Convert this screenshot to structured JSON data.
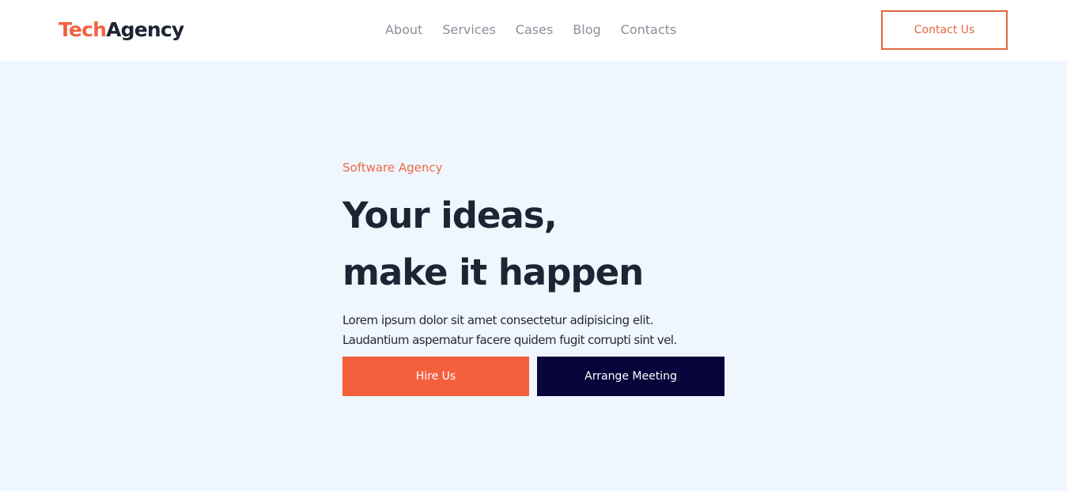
{
  "header": {
    "logo_part1": "Tech",
    "logo_part2": "Agency",
    "nav": [
      "About",
      "Services",
      "Cases",
      "Blog",
      "Contacts"
    ],
    "contact_button": "Contact Us"
  },
  "hero": {
    "eyebrow": "Software Agency",
    "headline_line1": "Your ideas,",
    "headline_line2": "make it happen",
    "lede_line1": "Lorem ipsum dolor sit amet consectetur adipisicing elit.",
    "lede_line2": "Laudantium aspernatur facere quidem fugit corrupti sint vel.",
    "primary_button": "Hire Us",
    "secondary_button": "Arrange Meeting"
  },
  "colors": {
    "accent": "#f4603c",
    "navy": "#08043b",
    "page_background": "#eff6fd",
    "text_dark": "#1d2433",
    "nav_gray": "#8a8f99"
  }
}
